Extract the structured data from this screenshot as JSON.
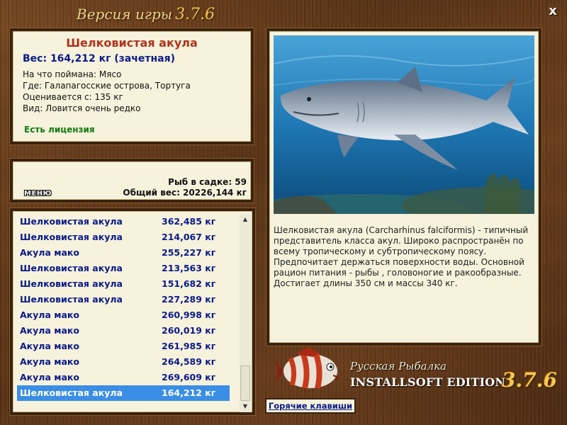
{
  "header": {
    "version_label": "Версия игры",
    "version_number": "3.7.6",
    "close_label": "x"
  },
  "catch": {
    "name": "Шелковистая акула",
    "weight": "Вес: 164,212 кг (зачетная)",
    "bait": "На что поймана: Мясо",
    "place": "Где: Галапагосские острова, Тортуга",
    "valued_from": "Оценивается с: 135 кг",
    "rarity": "Вид: Ловится очень редко",
    "license": "Есть лицензия"
  },
  "stats": {
    "menu_label": "МЕНЮ",
    "fish_in_cage": "Рыб в садке: 59",
    "total_weight": "Общий вес: 20226,144 кг"
  },
  "fish_list": [
    {
      "name": "Шелковистая акула",
      "weight": "362,485 кг"
    },
    {
      "name": "Шелковистая акула",
      "weight": "214,067 кг"
    },
    {
      "name": "Акула мако",
      "weight": "255,227 кг"
    },
    {
      "name": "Шелковистая акула",
      "weight": "213,563 кг"
    },
    {
      "name": "Шелковистая акула",
      "weight": "151,682 кг"
    },
    {
      "name": "Шелковистая акула",
      "weight": "227,289 кг"
    },
    {
      "name": "Акула мако",
      "weight": "260,998 кг"
    },
    {
      "name": "Акула мако",
      "weight": "260,019 кг"
    },
    {
      "name": "Акула мако",
      "weight": "261,985 кг"
    },
    {
      "name": "Акула мако",
      "weight": "264,589 кг"
    },
    {
      "name": "Акула мако",
      "weight": "269,609 кг"
    },
    {
      "name": "Шелковистая акула",
      "weight": "164,212 кг"
    }
  ],
  "selected_index": 11,
  "description": "Шелковистая акула (Carcharhinus falciformis) - типичный представитель класса акул. Широко распространён по всему тропическому и субтропическому поясу. Предпочитает держаться поверхности воды. Основной рацион питания - рыбы , головоногие и ракообразные. Достигает длины 350 см и массы 340 кг.",
  "brand": {
    "script": "Русская Рыбалка",
    "edition": "INSTALLSOFT EDITION",
    "version": "3.7.6"
  },
  "hotkeys_label": "Горячие клавиши",
  "colors": {
    "accent_red": "#b0331a",
    "accent_navy": "#0a1a8a",
    "license_green": "#117a11",
    "selection_blue": "#3a8ee6",
    "panel_bg": "#f6f2dc",
    "gold": "#f5c94a"
  },
  "icons": [
    "close-icon",
    "scroll-up-icon",
    "scroll-down-icon",
    "fish-logo-icon"
  ]
}
